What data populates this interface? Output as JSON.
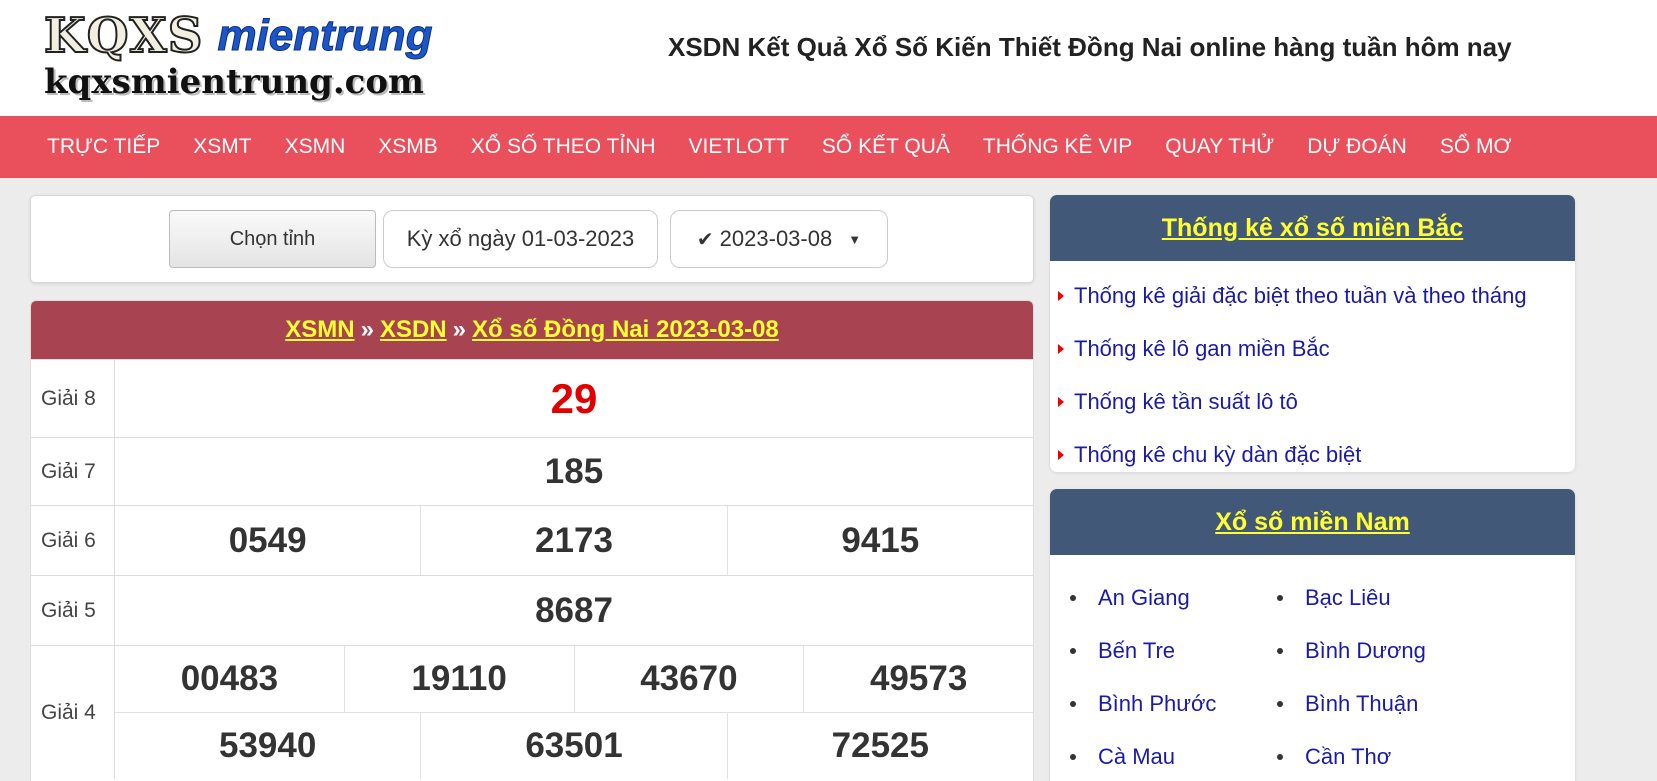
{
  "header": {
    "logo_brand": "KQXS",
    "logo_suffix": "mientrung",
    "logo_domain": "kqxsmientrung.com",
    "title": "XSDN Kết Quả Xổ Số Kiến Thiết Đồng Nai online hàng tuần hôm nay"
  },
  "nav": [
    "TRỰC TIẾP",
    "XSMT",
    "XSMN",
    "XSMB",
    "XỔ SỐ THEO TỈNH",
    "VIETLOTT",
    "SỔ KẾT QUẢ",
    "THỐNG KÊ VIP",
    "QUAY THỬ",
    "DỰ ĐOÁN",
    "SỔ MƠ"
  ],
  "filter": {
    "province_button": "Chọn tỉnh",
    "draw_date_label": "Kỳ xổ ngày 01-03-2023",
    "selected_date": "2023-03-08"
  },
  "results": {
    "crumb1": "XSMN",
    "crumb2": "XSDN",
    "crumb3": "Xổ số Đồng Nai 2023-03-08",
    "separator": "»",
    "rows": [
      {
        "label": "Giải 8",
        "lines": [
          [
            "29"
          ]
        ]
      },
      {
        "label": "Giải 7",
        "lines": [
          [
            "185"
          ]
        ]
      },
      {
        "label": "Giải 6",
        "lines": [
          [
            "0549",
            "2173",
            "9415"
          ]
        ]
      },
      {
        "label": "Giải 5",
        "lines": [
          [
            "8687"
          ]
        ]
      },
      {
        "label": "Giải 4",
        "lines": [
          [
            "00483",
            "19110",
            "43670",
            "49573"
          ],
          [
            "53940",
            "63501",
            "72525"
          ]
        ]
      }
    ]
  },
  "sidebar": {
    "panel1_title": "Thống kê xổ số miền Bắc",
    "panel1_links": [
      "Thống kê giải đặc biệt theo tuần và theo tháng",
      "Thống kê lô gan miền Bắc",
      "Thống kê tần suất lô tô",
      "Thống kê chu kỳ dàn đặc biệt"
    ],
    "panel2_title": "Xổ số miền Nam",
    "panel2_provinces": [
      "An Giang",
      "Bạc Liêu",
      "Bến Tre",
      "Bình Dương",
      "Bình Phước",
      "Bình Thuận",
      "Cà Mau",
      "Cần Thơ"
    ]
  },
  "colors": {
    "nav_bg": "#ea4f5c",
    "results_head_bg": "#a84451",
    "panel_head_bg": "#415878",
    "link_yellow": "#ffff33",
    "special_prize": "#e00000"
  }
}
